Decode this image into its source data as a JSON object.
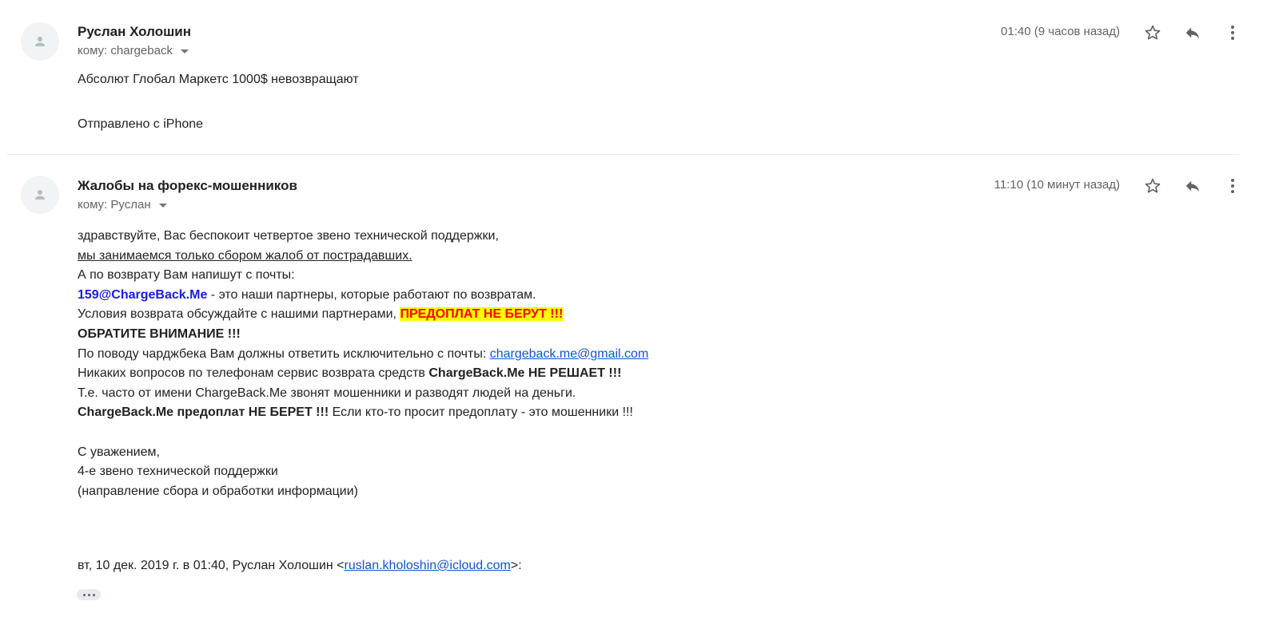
{
  "messages": [
    {
      "sender": "Руслан Холошин",
      "recipient": "кому: chargeback",
      "time": "01:40 (9 часов назад)",
      "body": {
        "line1": "Абсолют Глобал Маркетс 1000$ невозвращают",
        "signature": "Отправлено с iPhone"
      }
    },
    {
      "sender": "Жалобы на форекс-мошенников",
      "recipient": "кому: Руслан",
      "time": "11:10 (10 минут назад)",
      "body": {
        "line1": "здравствуйте, Вас беспокоит четвертое звено технической поддержки,",
        "line2": "мы занимаемся только сбором жалоб от пострадавших.",
        "line3": "А по возврату Вам напишут с почты:",
        "line4_email": "159@ChargeBack.Me",
        "line4_rest": " - это наши партнеры, которые работают по возвратам.",
        "line5_text": "Условия возврата обсуждайте с нашими партнерами, ",
        "line5_highlight": "ПРЕДОПЛАТ НЕ БЕРУТ !!!",
        "line6": "ОБРАТИТЕ ВНИМАНИЕ !!!",
        "line7_text": "По поводу чарджбека Вам должны ответить исключительно с почты: ",
        "line7_link": "chargeback.me@gmail.com",
        "line8_text": "Никаких вопросов по телефонам сервис возврата средств ",
        "line8_bold": "ChargeBack.Me НЕ РЕШАЕТ !!!",
        "line9": "Т.е. часто от имени ChargeBack.Me звонят мошенники и разводят людей на деньги.",
        "line10_bold": "ChargeBack.Me предоплат НЕ БЕРЕТ !!!",
        "line10_rest": " Если кто-то просит предоплату - это мошенники !!!",
        "sign1": "С уважением,",
        "sign2": "4-е звено технической поддержки",
        "sign3": "(направление сбора и обработки информации)"
      },
      "quote": {
        "prefix": "вт, 10 дек. 2019 г. в 01:40, Руслан Холошин <",
        "email": "ruslan.kholoshin@icloud.com",
        "suffix": ">:"
      }
    }
  ],
  "icons": {
    "avatar": "person-icon",
    "star": "star-icon",
    "reply": "reply-icon",
    "more": "more-vert-icon",
    "trimmed": "ellipsis-icon"
  },
  "colors": {
    "link": "#1155cc",
    "partner_email": "#1a1ae8",
    "highlight_bg": "#ffff00",
    "highlight_text": "#ff0000",
    "meta_gray": "#5f6368"
  }
}
